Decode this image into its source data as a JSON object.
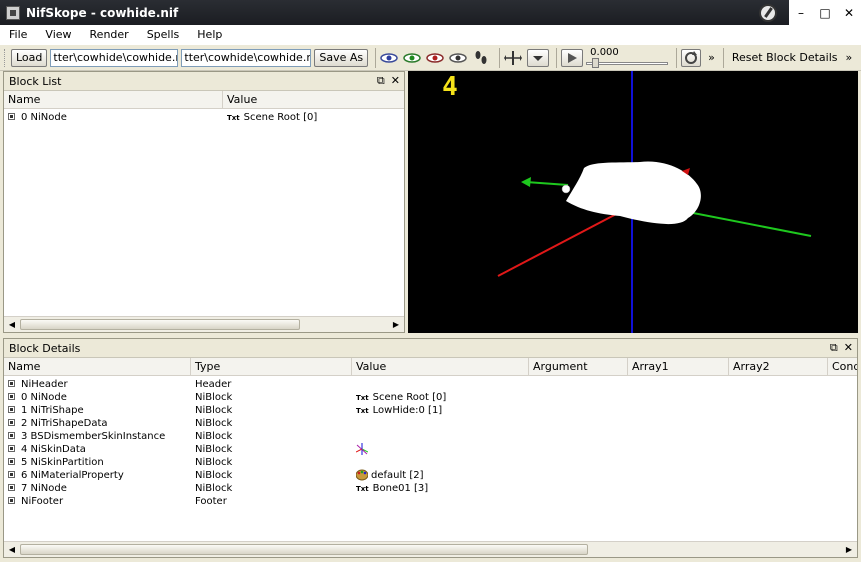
{
  "window": {
    "title": "NifSkope - cowhide.nif"
  },
  "menu": [
    "File",
    "View",
    "Render",
    "Spells",
    "Help"
  ],
  "toolbar": {
    "load_label": "Load",
    "load_path": "tter\\cowhide\\cowhide.nif",
    "save_path": "tter\\cowhide\\cowhide.nif",
    "save_as_label": "Save As",
    "time_value": "0.000",
    "reset_label": "Reset Block Details",
    "overflow": "»"
  },
  "block_list": {
    "title": "Block List",
    "columns": [
      "Name",
      "Value"
    ],
    "rows": [
      {
        "name": "0 NiNode",
        "value_tag": "Txt",
        "value": "Scene Root [0]"
      }
    ]
  },
  "viewport": {
    "lod_label": "4"
  },
  "block_details": {
    "title": "Block Details",
    "columns": [
      "Name",
      "Type",
      "Value",
      "Argument",
      "Array1",
      "Array2",
      "Cond"
    ],
    "rows": [
      {
        "name": "NiHeader",
        "type": "Header",
        "value": "",
        "tag": ""
      },
      {
        "name": "0 NiNode",
        "type": "NiBlock",
        "value": "Scene Root [0]",
        "tag": "Txt"
      },
      {
        "name": "1 NiTriShape",
        "type": "NiBlock",
        "value": "LowHide:0 [1]",
        "tag": "Txt"
      },
      {
        "name": "2 NiTriShapeData",
        "type": "NiBlock",
        "value": "",
        "tag": ""
      },
      {
        "name": "3 BSDismemberSkinInstance",
        "type": "NiBlock",
        "value": "",
        "tag": ""
      },
      {
        "name": "4 NiSkinData",
        "type": "NiBlock",
        "value": "",
        "tag": "axes"
      },
      {
        "name": "5 NiSkinPartition",
        "type": "NiBlock",
        "value": "",
        "tag": ""
      },
      {
        "name": "6 NiMaterialProperty",
        "type": "NiBlock",
        "value": "default [2]",
        "tag": "palette"
      },
      {
        "name": "7 NiNode",
        "type": "NiBlock",
        "value": "Bone01 [3]",
        "tag": "Txt"
      },
      {
        "name": "NiFooter",
        "type": "Footer",
        "value": "",
        "tag": ""
      }
    ]
  },
  "colors": {
    "x_axis": "#e01818",
    "y_axis": "#1ec81e",
    "z_axis": "#1010d8",
    "lod_text": "#f5e21a"
  }
}
